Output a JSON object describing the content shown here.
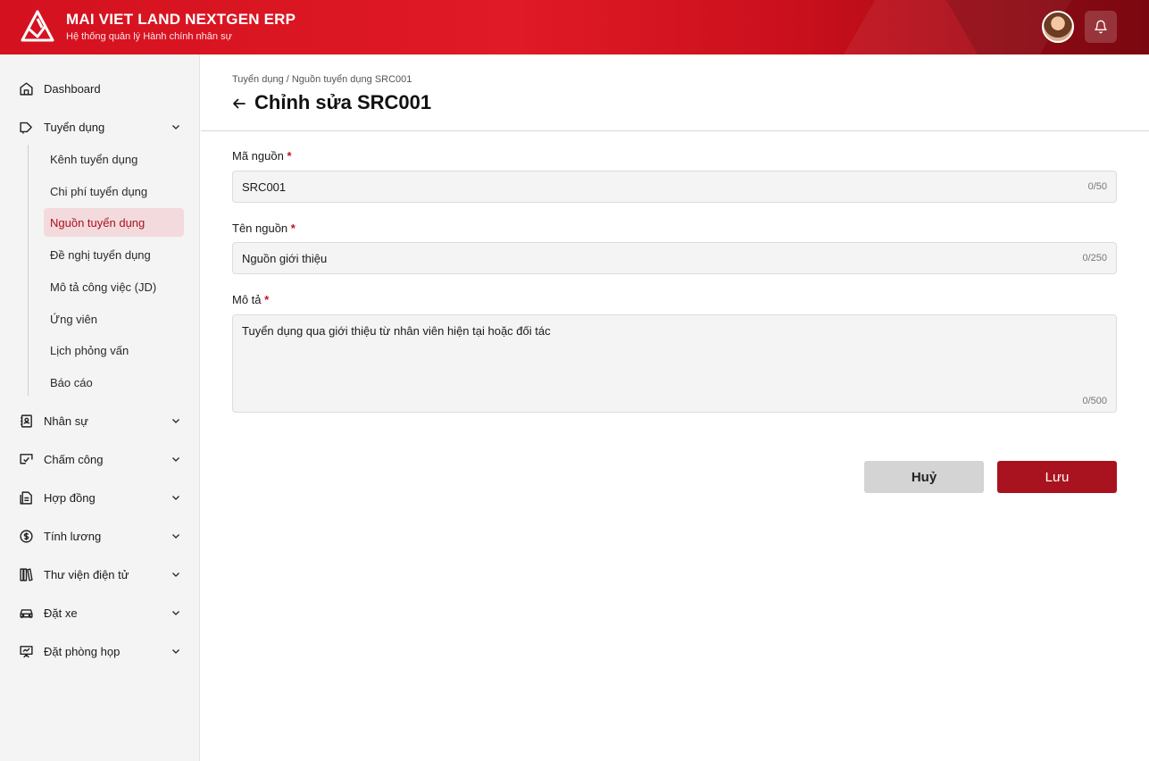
{
  "header": {
    "title": "MAI VIET LAND NEXTGEN ERP",
    "subtitle": "Hệ thống quản lý Hành chính nhân sự"
  },
  "sidebar": {
    "items": [
      {
        "label": "Dashboard",
        "icon": "home-icon"
      },
      {
        "label": "Tuyển dụng",
        "icon": "megaphone-icon",
        "expanded": true
      },
      {
        "label": "Nhân sự",
        "icon": "contact-book-icon"
      },
      {
        "label": "Chấm công",
        "icon": "clock-check-icon"
      },
      {
        "label": "Hợp đồng",
        "icon": "document-icon"
      },
      {
        "label": "Tính lương",
        "icon": "dollar-circle-icon"
      },
      {
        "label": "Thư viện điện tử",
        "icon": "library-icon"
      },
      {
        "label": "Đặt xe",
        "icon": "car-icon"
      },
      {
        "label": "Đặt phòng họp",
        "icon": "presentation-icon"
      }
    ],
    "sub_items": [
      "Kênh tuyển dụng",
      "Chi phí tuyển dụng",
      "Nguồn tuyển dụng",
      "Đề nghị tuyển dụng",
      "Mô tả công việc (JD)",
      "Ứng viên",
      "Lịch phỏng vấn",
      "Báo cáo"
    ],
    "active_sub_item": "Nguồn tuyển dụng"
  },
  "main": {
    "breadcrumb": "Tuyển dụng / Nguồn tuyển dụng SRC001",
    "title": "Chỉnh sửa SRC001",
    "fields": {
      "code": {
        "label": "Mã nguồn",
        "required": "*",
        "value": "SRC001",
        "counter": "0/50"
      },
      "name": {
        "label": "Tên nguồn",
        "required": "*",
        "value": "Nguồn giới thiệu",
        "counter": "0/250"
      },
      "description": {
        "label": "Mô tả",
        "required": "*",
        "value": "Tuyển dụng qua giới thiệu từ nhân viên hiện tại hoặc đối tác",
        "counter": "0/500"
      }
    },
    "buttons": {
      "cancel": "Huỷ",
      "save": "Lưu"
    }
  },
  "colors": {
    "brand_red": "#d4111f",
    "save_button": "#a8131f",
    "active_nav_bg": "#f3dadd",
    "active_nav_text": "#a8121f"
  }
}
